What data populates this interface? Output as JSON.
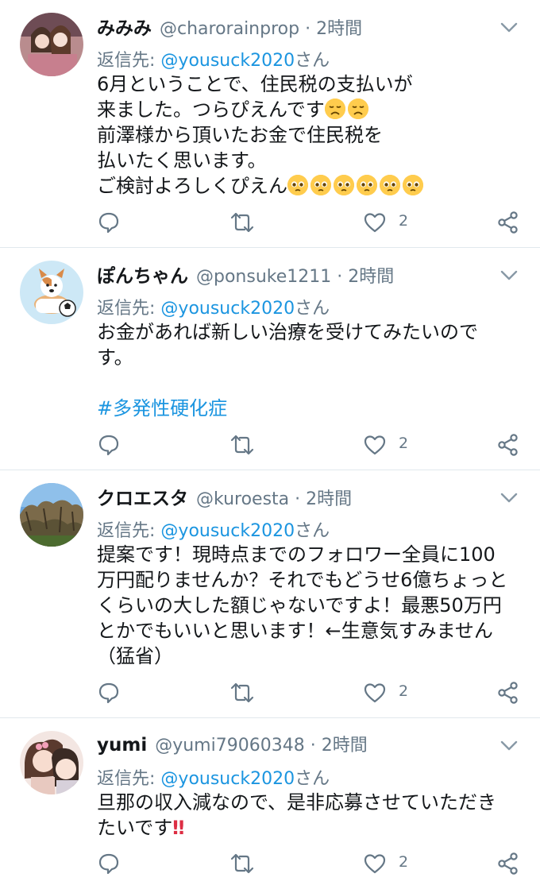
{
  "colors": {
    "accent": "#1b95e0",
    "muted": "#657786",
    "divider": "#e1e8ed",
    "emoji": "#ffcc4d",
    "alert": "#dd2e44"
  },
  "tweets": [
    {
      "name": "みみみ",
      "handle": "@charorainprop",
      "time": "2時間",
      "reply_prefix": "返信先:",
      "reply_mention": "@yousuck2020",
      "reply_suffix": "さん",
      "lines": [
        "6月ということで、住民税の支払いが",
        "来ました。つらぴえんです",
        "前澤様から頂いたお金で住民税を",
        "払いたく思います。",
        "ご検討よろしくぴえん"
      ],
      "emoji": [
        "disappointed-face-emoji",
        "pleading-face-emoji"
      ],
      "like_count": "2"
    },
    {
      "name": "ぽんちゃん",
      "handle": "@ponsuke1211",
      "time": "2時間",
      "reply_prefix": "返信先:",
      "reply_mention": "@yousuck2020",
      "reply_suffix": "さん",
      "lines": [
        "お金があれば新しい治療を受けてみたいので",
        "す。"
      ],
      "hashtag": "#多発性硬化症",
      "like_count": "2"
    },
    {
      "name": "クロエスタ",
      "handle": "@kuroesta",
      "time": "2時間",
      "reply_prefix": "返信先:",
      "reply_mention": "@yousuck2020",
      "reply_suffix": "さん",
      "lines": [
        "提案です！現時点までのフォロワー全員に100",
        "万円配りませんか？それでもどうせ6億ちょっと",
        "くらいの大した額じゃないですよ！最悪50万円",
        "とかでもいいと思います！←生意気すみません",
        "（猛省）"
      ],
      "like_count": "2"
    },
    {
      "name": "yumi",
      "handle": "@yumi79060348",
      "time": "2時間",
      "reply_prefix": "返信先:",
      "reply_mention": "@yousuck2020",
      "reply_suffix": "さん",
      "lines": [
        "旦那の収入減なので、是非応募させていただき",
        "たいです"
      ],
      "emoji": [
        "double-exclamation-emoji"
      ],
      "like_count": "2"
    }
  ]
}
